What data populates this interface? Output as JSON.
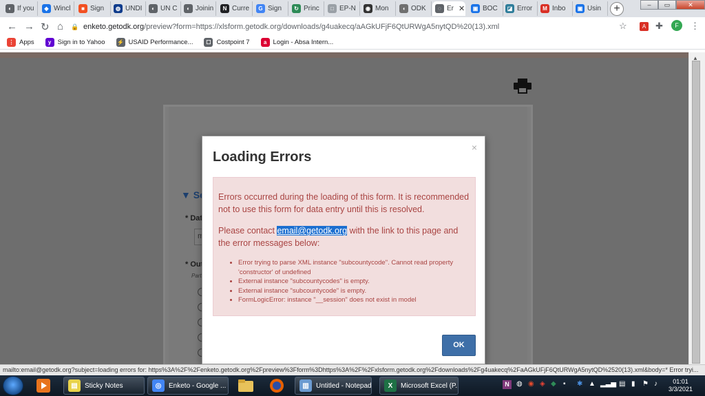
{
  "browser": {
    "tabs": [
      {
        "label": "If you",
        "color": "#5f6368",
        "glyph": "◐"
      },
      {
        "label": "Wincl",
        "color": "#1a73e8",
        "glyph": "◆"
      },
      {
        "label": "Sign",
        "color": "#f25022",
        "glyph": "■"
      },
      {
        "label": "UNDI",
        "color": "#0f3c8c",
        "glyph": "◍"
      },
      {
        "label": "UN C",
        "color": "#5f6368",
        "glyph": "◐"
      },
      {
        "label": "Joinin",
        "color": "#5f6368",
        "glyph": "◐"
      },
      {
        "label": "Curre",
        "color": "#202124",
        "glyph": "N"
      },
      {
        "label": "Sign",
        "color": "#4285f4",
        "glyph": "G"
      },
      {
        "label": "Princ",
        "color": "#2e8b57",
        "glyph": "↻"
      },
      {
        "label": "EP-N",
        "color": "#9aa0a6",
        "glyph": "□"
      },
      {
        "label": "Mon",
        "color": "#333333",
        "glyph": "◉"
      },
      {
        "label": "ODK",
        "color": "#707070",
        "glyph": "◖"
      },
      {
        "label": "Er",
        "color": "#5f6368",
        "glyph": "◌",
        "active": true
      },
      {
        "label": "BOC",
        "color": "#1a73e8",
        "glyph": "▣"
      },
      {
        "label": "Error",
        "color": "#2e7d9a",
        "glyph": "◪"
      },
      {
        "label": "Inbo",
        "color": "#d93025",
        "glyph": "M"
      },
      {
        "label": "Usin",
        "color": "#1a73e8",
        "glyph": "▣"
      }
    ],
    "url_host": "enketo.getodk.org",
    "url_path": "/preview?form=https://xlsform.getodk.org/downloads/g4uakecq/aAGkUFjF6QtURWgA5nytQD%20(13).xml",
    "profile_initial": "F",
    "bookmarks": [
      {
        "label": "Apps",
        "color": "#ea4335",
        "glyph": "⋮"
      },
      {
        "label": "Sign in to Yahoo",
        "color": "#6001d2",
        "glyph": "y"
      },
      {
        "label": "USAID Performance...",
        "color": "#5f6368",
        "glyph": "⚡"
      },
      {
        "label": "Costpoint 7",
        "color": "#5f6368",
        "glyph": "☐"
      },
      {
        "label": "Login - Absa Intern...",
        "color": "#dc0032",
        "glyph": "a"
      }
    ]
  },
  "form": {
    "section_label": "Se",
    "q1_label": "Dat",
    "q1_value": "m",
    "q2_label": "Out",
    "q2_hint": "Parti"
  },
  "dialog": {
    "title": "Loading Errors",
    "close_symbol": "×",
    "message": "Errors occurred during the loading of this form. It is recommended not to use this form for data entry until this is resolved.",
    "contact_prefix": "Please contact ",
    "contact_email": "email@getodk.org",
    "contact_suffix": " with the link to this page and the error messages below:",
    "errors": [
      "Error trying to parse XML instance \"subcountycode\". Cannot read property 'constructor' of undefined",
      "External instance \"subcountycodes\" is empty.",
      "External instance \"subcountycode\" is empty.",
      "FormLogicError: instance \"__session\" does not exist in model"
    ],
    "ok_label": "OK"
  },
  "status_bar": "mailto:email@getodk.org?subject=loading errors for: https%3A%2F%2Fenketo.getodk.org%2Fpreview%3Fform%3Dhttps%3A%2F%2Fxlsform.getodk.org%2Fdownloads%2Fg4uakecq%2FaAGkUFjF6QtURWgA5nytQD%2520(13).xml&body=* Error tryi...",
  "taskbar": {
    "tasks": [
      {
        "label": "Sticky Notes",
        "color": "#e9d34a",
        "glyph": "▤"
      },
      {
        "label": "Enketo - Google ...",
        "color": "#4285f4",
        "glyph": "◎"
      },
      {
        "label": "Untitled - Notepad",
        "color": "#6b9bd1",
        "glyph": "▥"
      },
      {
        "label": "Microsoft Excel (P...",
        "color": "#1e7145",
        "glyph": "X"
      }
    ],
    "time": "01:01",
    "date": "3/3/2021"
  }
}
